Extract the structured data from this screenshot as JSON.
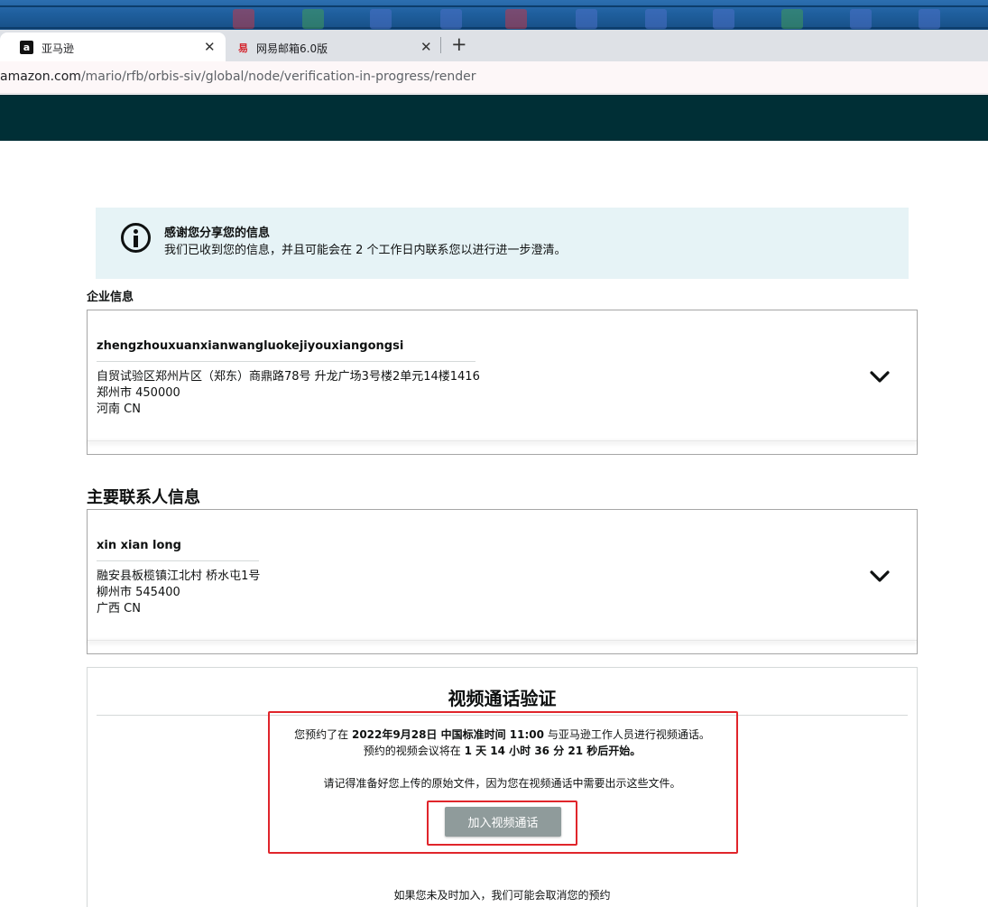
{
  "browser": {
    "tabs": [
      {
        "title": "亚马逊",
        "favicon": "amazon-icon",
        "close": "✕"
      },
      {
        "title": "网易邮箱6.0版",
        "favicon": "netease-mail-icon",
        "close": "✕"
      }
    ],
    "new_tab": "+",
    "url_host": "amazon.com",
    "url_path": "/mario/rfb/orbis-siv/global/node/verification-in-progress/render"
  },
  "colors": {
    "header_bg": "#002f36",
    "notice_bg": "#e6f3f6",
    "button_bg": "#8f9b9b",
    "highlight": "#e0252b"
  },
  "notice": {
    "title": "感谢您分享您的信息",
    "text": "我们已收到您的信息，并且可能会在 2 个工作日内联系您以进行进一步澄清。"
  },
  "business": {
    "section_label": "企业信息",
    "name": "zhengzhouxuanxianwangluokejiyouxiangongsi",
    "address_line1": "自贸试验区郑州片区（郑东）商鼎路78号 升龙广场3号楼2单元14楼1416",
    "address_line2": "郑州市 450000",
    "address_line3": "河南 CN"
  },
  "contact": {
    "section_label": "主要联系人信息",
    "name": "xin xian long",
    "address_line1": "融安县板榄镇江北村 桥水屯1号",
    "address_line2": "柳州市 545400",
    "address_line3": "广西 CN"
  },
  "video": {
    "title": "视频通话验证",
    "line1_pre": "您预约了在 ",
    "line1_date": "2022年9月28日 中国标准时间 11:00",
    "line1_post": " 与亚马逊工作人员进行视频通话。",
    "line2_pre": "预约的视频会议将在 ",
    "line2_countdown": "1 天 14 小时 36 分 21 秒后开始。",
    "line3": "请记得准备好您上传的原始文件，因为您在视频通话中需要出示这些文件。",
    "join_button": "加入视频通话",
    "footer_note": "如果您未及时加入，我们可能会取消您的预约"
  }
}
